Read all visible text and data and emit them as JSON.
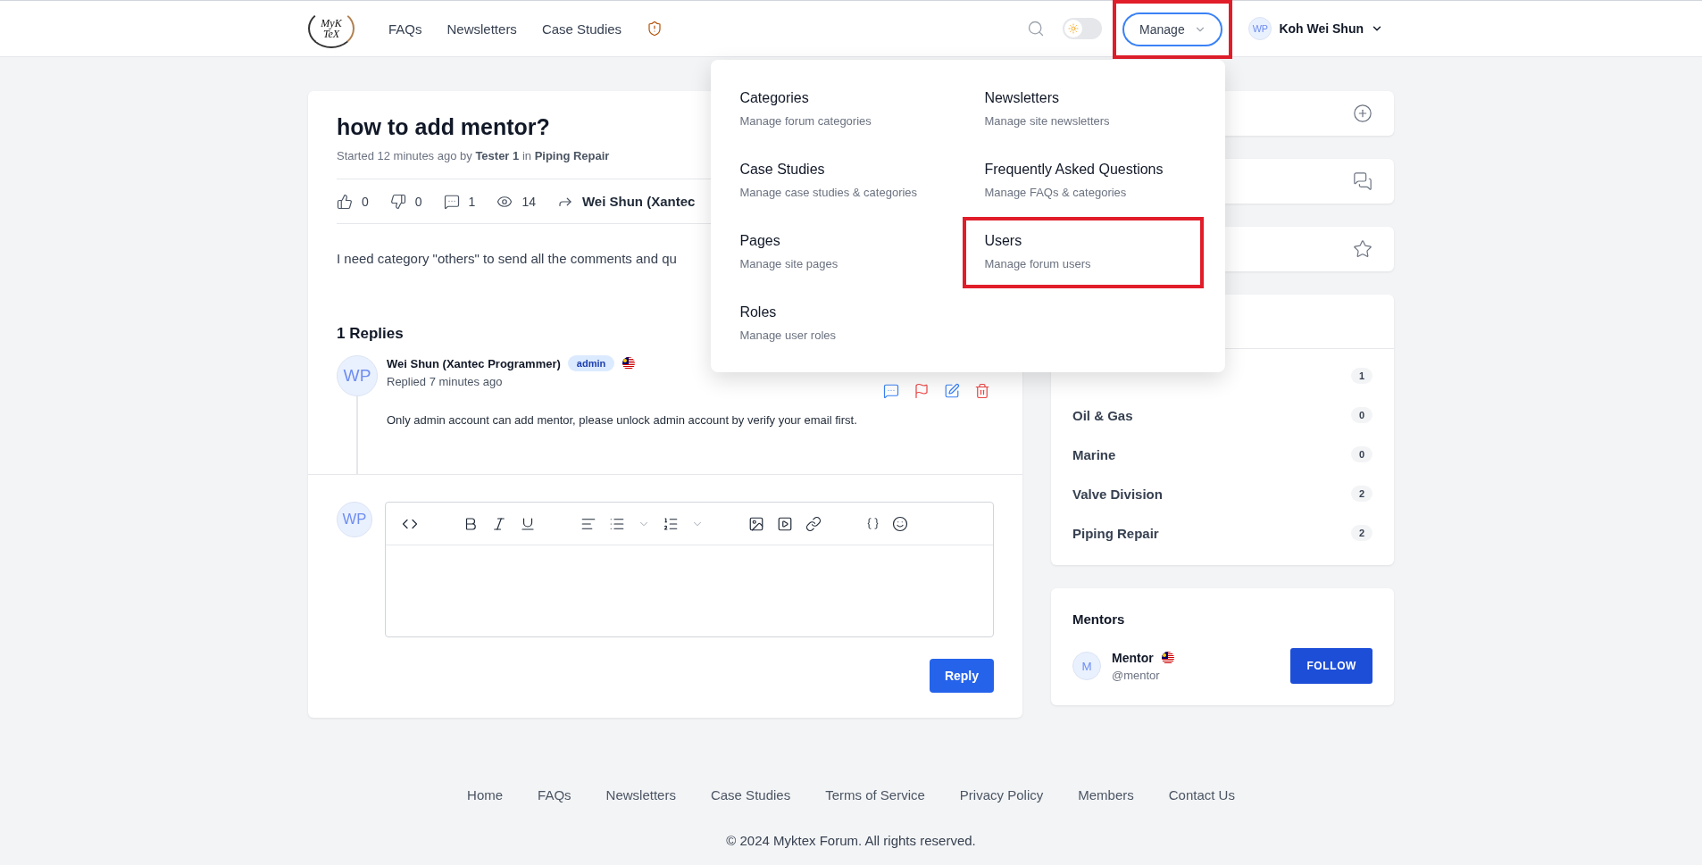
{
  "header": {
    "logo": {
      "top": "MyK",
      "bottom": "TeX"
    },
    "nav": [
      "FAQs",
      "Newsletters",
      "Case Studies"
    ],
    "theme_toggle": {
      "on": false
    },
    "manage": {
      "label": "Manage",
      "highlighted": true,
      "expanded": true
    },
    "user": {
      "initials": "WP",
      "name": "Koh Wei Shun"
    }
  },
  "manage_menu": [
    {
      "title": "Categories",
      "description": "Manage forum categories",
      "highlighted": false
    },
    {
      "title": "Newsletters",
      "description": "Manage site newsletters",
      "highlighted": false
    },
    {
      "title": "Case Studies",
      "description": "Manage case studies & categories",
      "highlighted": false
    },
    {
      "title": "Frequently Asked Questions",
      "description": "Manage FAQs & categories",
      "highlighted": false
    },
    {
      "title": "Pages",
      "description": "Manage site pages",
      "highlighted": false
    },
    {
      "title": "Users",
      "description": "Manage forum users",
      "highlighted": true
    },
    {
      "title": "Roles",
      "description": "Manage user roles",
      "highlighted": false
    }
  ],
  "post": {
    "title": "how to add mentor?",
    "meta": "Started 12 minutes ago by **Tester 1** in **Piping Repair**",
    "stats": {
      "likes": "0",
      "dislikes": "0",
      "comments": "1",
      "views": "14",
      "shared_by": "Wei Shun (Xantec"
    },
    "body": "I need category \"others\" to send all the comments and qu"
  },
  "replies": {
    "heading": "1 Replies",
    "items": [
      {
        "initials": "WP",
        "author": "Wei Shun (Xantec Programmer)",
        "badge": "admin",
        "time": "Replied 7 minutes ago",
        "text": "Only admin account can add mentor, please unlock admin account by verify your email first."
      }
    ]
  },
  "composer": {
    "initials": "WP",
    "submit": "Reply"
  },
  "sidebar": {
    "categories": [
      {
        "count": "1"
      },
      {
        "name": "Oil & Gas",
        "count": "0"
      },
      {
        "name": "Marine",
        "count": "0"
      },
      {
        "name": "Valve Division",
        "count": "2"
      },
      {
        "name": "Piping Repair",
        "count": "2"
      }
    ],
    "mentors": {
      "title": "Mentors",
      "items": [
        {
          "initial": "M",
          "name": "Mentor",
          "handle": "@mentor",
          "action": "FOLLOW"
        }
      ]
    }
  },
  "footer": {
    "links": [
      "Home",
      "FAQs",
      "Newsletters",
      "Case Studies",
      "Terms of Service",
      "Privacy Policy",
      "Members",
      "Contact Us"
    ],
    "copyright": "© 2024 Myktex Forum. All rights reserved."
  }
}
